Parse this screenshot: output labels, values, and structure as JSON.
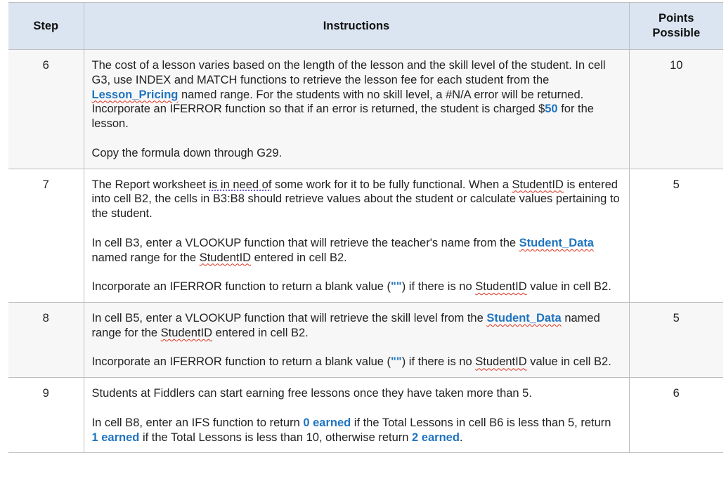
{
  "table": {
    "headers": {
      "step": "Step",
      "instructions": "Instructions",
      "points": "Points Possible"
    },
    "rows": [
      {
        "step": "6",
        "points": "10",
        "p1": {
          "a": "The cost of a lesson varies based on the length of the lesson and the skill level of the student. In cell G3, use INDEX and MATCH functions to retrieve the lesson fee for each student from the ",
          "named_range": "Lesson_Pricing",
          "b": " named range. For the students with no skill level, a #N/A error will be returned. Incorporate an IFERROR function so that if an error is returned, the student is charged $",
          "amount": "50",
          "c": " for the lesson."
        },
        "p2": "Copy the formula down through G29."
      },
      {
        "step": "7",
        "points": "5",
        "p1": {
          "a": "The Report worksheet ",
          "grammar": "is in need of",
          "b": " some work for it to be fully functional. When a ",
          "id": "StudentID",
          "c": " is entered into cell B2, the cells in B3:B8 should retrieve values about the student or calculate values pertaining to the student."
        },
        "p2": {
          "a": "In cell B3, enter a VLOOKUP function that will retrieve the teacher's name from the ",
          "named_range": "Student_Data",
          "b": " named range for the ",
          "id": "StudentID",
          "c": " entered in cell B2."
        },
        "p3": {
          "a": "Incorporate an IFERROR function to return a blank value (",
          "blank": "\"\"",
          "b": ") if there is no ",
          "id": "StudentID",
          "c": " value in cell B2."
        }
      },
      {
        "step": "8",
        "points": "5",
        "p1": {
          "a": "In cell B5, enter a VLOOKUP function that will retrieve the skill level from the ",
          "named_range": "Student_Data",
          "b": " named range for the ",
          "id": "StudentID",
          "c": " entered in cell B2."
        },
        "p2": {
          "a": "Incorporate an IFERROR function to return a blank value (",
          "blank": "\"\"",
          "b": ") if there is no ",
          "id": "StudentID",
          "c": " value in cell B2."
        }
      },
      {
        "step": "9",
        "points": "6",
        "p1": "Students at Fiddlers can start earning free lessons once they have taken more than 5.",
        "p2": {
          "a": "In cell B8, enter an IFS function to return ",
          "v0": "0 earned",
          "b": " if the Total Lessons in cell B6 is less than 5, return ",
          "v1": "1 earned",
          "c": " if the Total Lessons is less than 10, otherwise return ",
          "v2": "2 earned",
          "d": "."
        }
      }
    ]
  },
  "colors": {
    "header_bg": "#dbe5f1",
    "shaded_row_bg": "#f7f7f7",
    "highlight": "#1f74c0",
    "border": "#bfbfbf"
  }
}
